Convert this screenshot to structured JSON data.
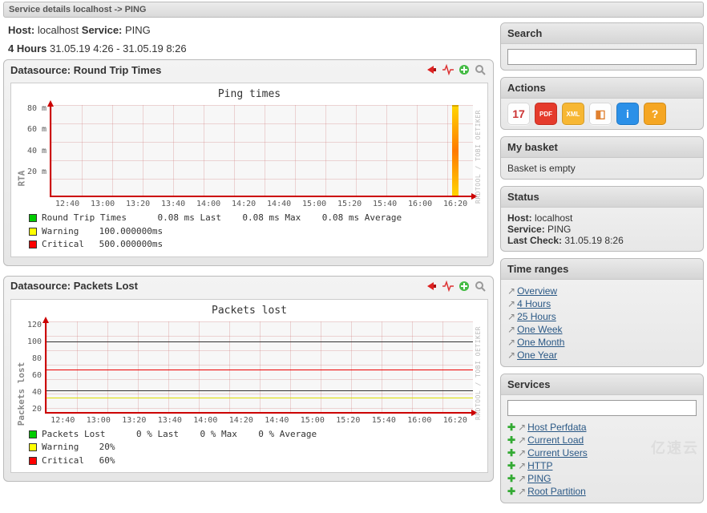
{
  "titlebar": "Service details localhost -> PING",
  "header": {
    "host_label": "Host:",
    "host": "localhost",
    "service_label": "Service:",
    "service": "PING",
    "range_label": "4 Hours",
    "range_value": "31.05.19 4:26 - 31.05.19 8:26"
  },
  "chart_data": [
    {
      "type": "bar",
      "panel_title": "Datasource: Round Trip Times",
      "title": "Ping times",
      "ylabel": "RTA",
      "xlabel": "",
      "yticks": [
        "80 m",
        "60 m",
        "40 m",
        "20 m"
      ],
      "xticks": [
        "12:40",
        "13:00",
        "13:20",
        "13:40",
        "14:00",
        "14:20",
        "14:40",
        "15:00",
        "15:20",
        "15:40",
        "16:00",
        "16:20"
      ],
      "ylim": [
        0,
        90
      ],
      "series": [
        {
          "name": "Round Trip Times",
          "color": "#00cc00",
          "stats": "0.08 ms Last    0.08 ms Max    0.08 ms Average"
        },
        {
          "name": "Warning",
          "color": "#ffff00",
          "threshold": "100.000000ms"
        },
        {
          "name": "Critical",
          "color": "#ff0000",
          "threshold": "500.000000ms"
        }
      ],
      "note": "single right-edge spike near max"
    },
    {
      "type": "line",
      "panel_title": "Datasource: Packets Lost",
      "title": "Packets lost",
      "ylabel": "Packets lost",
      "xlabel": "",
      "yticks": [
        "120",
        "100",
        "80",
        "60",
        "40",
        "20"
      ],
      "xticks": [
        "12:40",
        "13:00",
        "13:20",
        "13:40",
        "14:00",
        "14:20",
        "14:40",
        "15:00",
        "15:20",
        "15:40",
        "16:00",
        "16:20"
      ],
      "ylim": [
        0,
        130
      ],
      "series": [
        {
          "name": "Packets Lost",
          "color": "#00cc00",
          "stats": "0 % Last    0 % Max    0 % Average",
          "values_flat_at": 0
        },
        {
          "name": "Warning",
          "color": "#ffff00",
          "threshold": "20%",
          "hline_at": 20
        },
        {
          "name": "Critical",
          "color": "#ff0000",
          "threshold": "60%",
          "hline_at": 60
        }
      ]
    }
  ],
  "graph_credit": "RRDTOOL / TOBI OETIKER",
  "sidebar": {
    "search": {
      "title": "Search",
      "value": ""
    },
    "actions": {
      "title": "Actions",
      "icons": [
        {
          "name": "calendar-icon",
          "glyph": "17",
          "bg": "#fefefe",
          "fg": "#c33"
        },
        {
          "name": "pdf-icon",
          "glyph": "PDF",
          "bg": "#e53b2c",
          "fg": "#fff"
        },
        {
          "name": "xml-icon",
          "glyph": "XML",
          "bg": "#f7b733",
          "fg": "#fff"
        },
        {
          "name": "page-icon",
          "glyph": "◧",
          "bg": "#fefefe",
          "fg": "#e08030"
        },
        {
          "name": "info-icon",
          "glyph": "i",
          "bg": "#2b90e8",
          "fg": "#fff"
        },
        {
          "name": "help-icon",
          "glyph": "?",
          "bg": "#f5a623",
          "fg": "#fff"
        }
      ]
    },
    "basket": {
      "title": "My basket",
      "text": "Basket is empty"
    },
    "status": {
      "title": "Status",
      "host_label": "Host:",
      "host": "localhost",
      "service_label": "Service:",
      "service": "PING",
      "lastcheck_label": "Last Check:",
      "lastcheck": "31.05.19 8:26"
    },
    "timeranges": {
      "title": "Time ranges",
      "items": [
        "Overview",
        "4 Hours",
        "25 Hours",
        "One Week",
        "One Month",
        "One Year"
      ]
    },
    "services": {
      "title": "Services",
      "filter": "",
      "items": [
        "Host Perfdata",
        "Current Load",
        "Current Users",
        "HTTP",
        "PING",
        "Root Partition"
      ]
    }
  },
  "icons": {
    "horn": "red-horn-icon",
    "pulse": "pulse-icon",
    "plus": "plus-circle-icon",
    "search": "magnifier-icon"
  },
  "watermark": "亿速云"
}
